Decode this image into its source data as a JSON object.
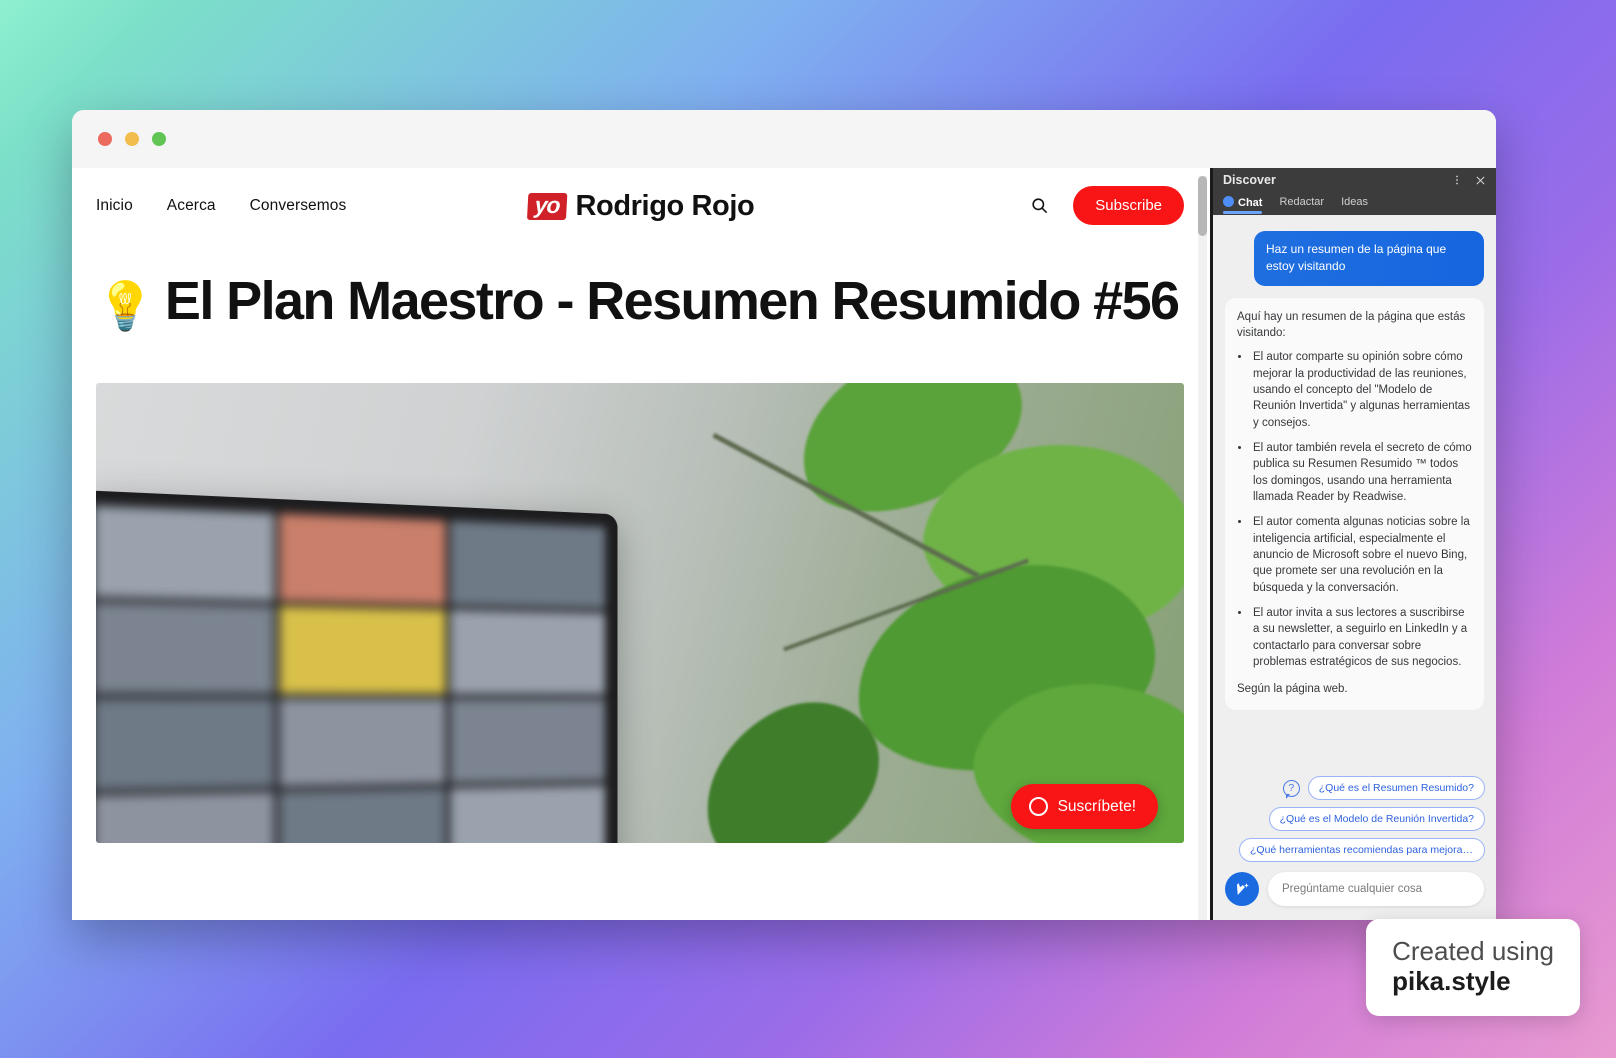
{
  "window": {
    "traffic_lights": [
      "close",
      "minimize",
      "maximize"
    ]
  },
  "site": {
    "nav": [
      {
        "label": "Inicio"
      },
      {
        "label": "Acerca"
      },
      {
        "label": "Conversemos"
      }
    ],
    "brand": {
      "badge": "yo",
      "name": "Rodrigo Rojo"
    },
    "search_icon": "search-icon",
    "subscribe_label": "Subscribe",
    "article": {
      "emoji": "💡",
      "title": "El Plan Maestro - Resumen Resumido #56"
    },
    "floating_subscribe_label": "Suscríbete!"
  },
  "panel": {
    "title": "Discover",
    "more_icon": "more-vertical-icon",
    "close_icon": "close-icon",
    "tabs": [
      {
        "label": "Chat",
        "active": true
      },
      {
        "label": "Redactar",
        "active": false
      },
      {
        "label": "Ideas",
        "active": false
      }
    ],
    "messages": {
      "user": "Haz un resumen de la página que estoy visitando",
      "bot_intro": "Aquí hay un resumen de la página que estás visitando:",
      "bot_bullets": [
        "El autor comparte su opinión sobre cómo mejorar la productividad de las reuniones, usando el concepto del \"Modelo de Reunión Invertida\" y algunas herramientas y consejos.",
        "El autor también revela el secreto de cómo publica su Resumen Resumido ™ todos los domingos, usando una herramienta llamada Reader by Readwise.",
        "El autor comenta algunas noticias sobre la inteligencia artificial, especialmente el anuncio de Microsoft sobre el nuevo Bing, que promete ser una revolución en la búsqueda y la conversación.",
        "El autor invita a sus lectores a suscribirse a su newsletter, a seguirlo en LinkedIn y a contactarlo para conversar sobre problemas estratégicos de sus negocios."
      ],
      "bot_source": "Según la página web."
    },
    "suggestions": [
      "¿Qué es el Resumen Resumido?",
      "¿Qué es el Modelo de Reunión Invertida?",
      "¿Qué herramientas recomiendas para mejorar las..."
    ],
    "suggestion_icon": "question-bubble-icon",
    "composer": {
      "avatar_icon": "bing-sparkle-icon",
      "placeholder": "Pregúntame cualquier cosa"
    }
  },
  "watermark": {
    "line1": "Created using",
    "line2": "pika.style"
  },
  "colors": {
    "brand_red": "#cf2127",
    "subscribe_red": "#f91515",
    "accent_blue": "#1a6ae0",
    "chip_blue": "#2f62e0",
    "panel_dark": "#3c3c3c"
  }
}
